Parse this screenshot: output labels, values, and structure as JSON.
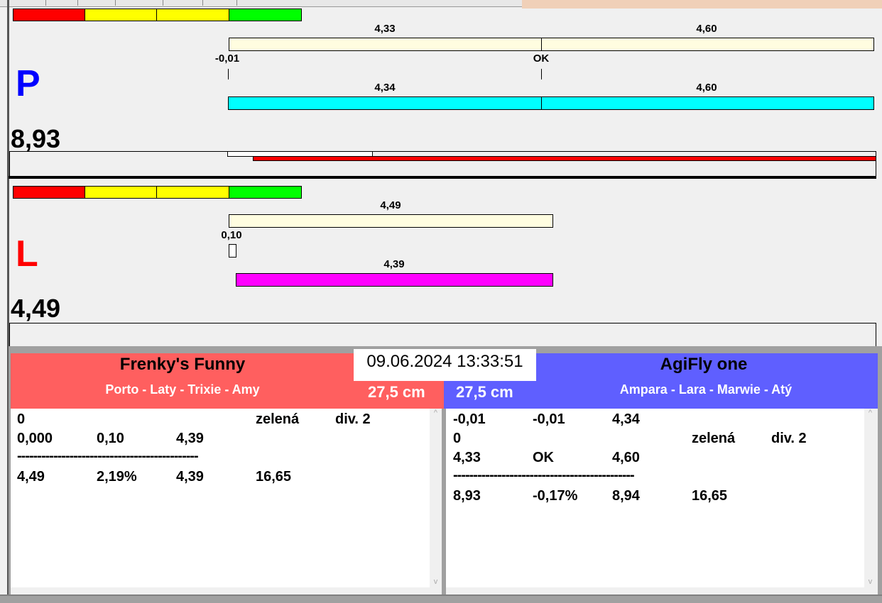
{
  "colors": {
    "red": "#ff0000",
    "yellow": "#ffff00",
    "green": "#00ff00",
    "beige": "#fffde0",
    "cyan": "#00ffff",
    "magenta": "#ff00ff",
    "team_left": "#ff5f5f",
    "team_right": "#5f5fff"
  },
  "panel_p": {
    "letter": "P",
    "total": "8,93",
    "bar1_left": "4,33",
    "bar1_right": "4,60",
    "mark_left": "-0,01",
    "mark_right": "OK",
    "bar2_left": "4,34",
    "bar2_right": "4,60"
  },
  "panel_l": {
    "letter": "L",
    "total": "4,49",
    "bar1": "4,49",
    "mark": "0,10",
    "bar2": "4,39"
  },
  "datetime": "09.06.2024 13:33:51",
  "left_team": {
    "name": "Frenky's Funny",
    "dogs": "Porto - Laty - Trixie - Amy",
    "height": "27,5 cm",
    "rows": [
      [
        "0",
        "",
        "",
        "zelená",
        "div. 2"
      ],
      [
        "0,000",
        "0,10",
        "4,39",
        "",
        ""
      ],
      [
        "---------------------------------------------"
      ],
      [
        "4,49",
        "2,19%",
        "4,39",
        "16,65",
        ""
      ]
    ]
  },
  "right_team": {
    "name": "AgiFly one",
    "dogs": "Ampara - Lara - Marwie - Atý",
    "height": "27,5 cm",
    "rows": [
      [
        "-0,01",
        "-0,01",
        "4,34",
        "",
        ""
      ],
      [
        "0",
        "",
        "",
        "zelená",
        "div. 2"
      ],
      [
        "4,33",
        "OK",
        "4,60",
        "",
        ""
      ],
      [
        "---------------------------------------------"
      ],
      [
        "8,93",
        "-0,17%",
        "8,94",
        "16,65",
        ""
      ]
    ]
  },
  "scroll": {
    "up": "^",
    "down": "v"
  }
}
